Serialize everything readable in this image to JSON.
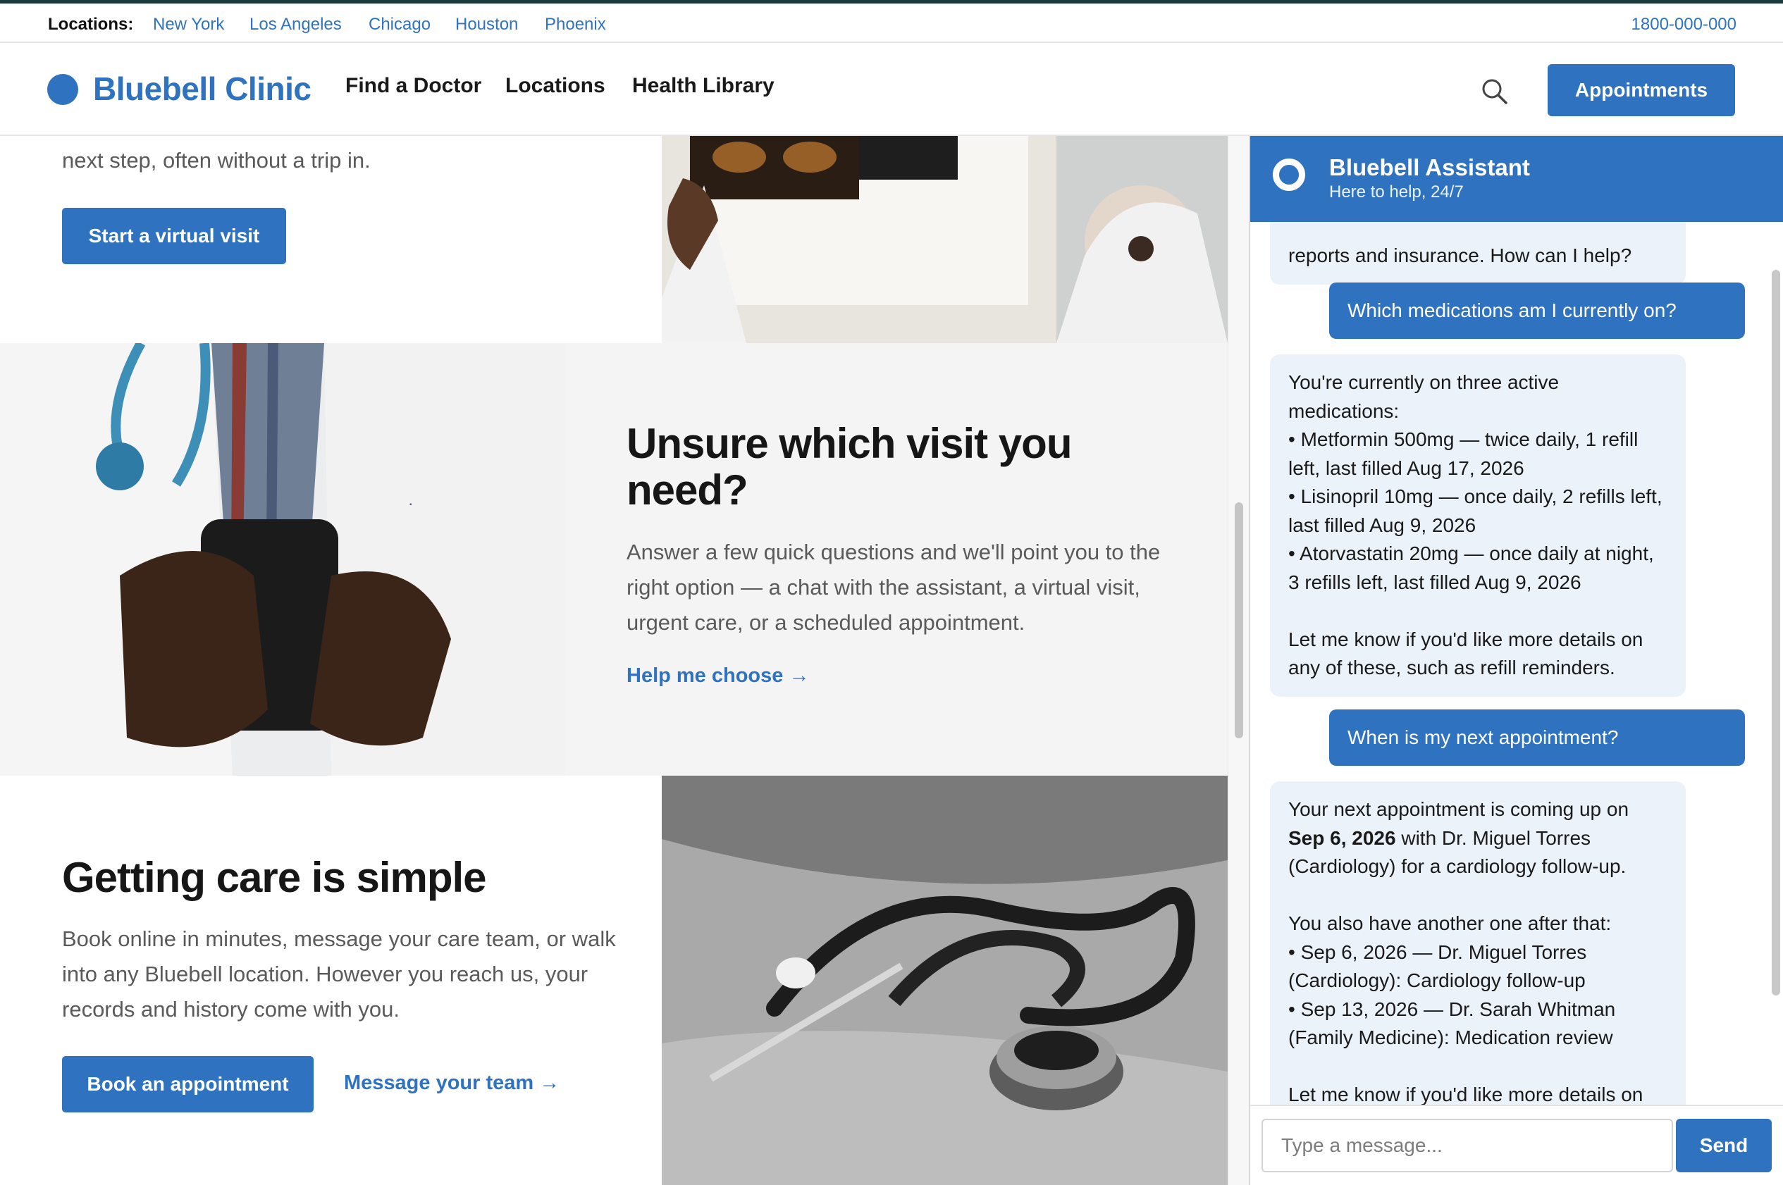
{
  "locations_bar": {
    "label": "Locations:",
    "links": [
      "New York",
      "Los Angeles",
      "Chicago",
      "Houston",
      "Phoenix"
    ],
    "phone": "1800-000-000"
  },
  "header": {
    "brand": "Bluebell Clinic",
    "nav": [
      "Find a Doctor",
      "Locations",
      "Health Library"
    ],
    "cta": "Appointments"
  },
  "sections": {
    "virtual": {
      "body": "next step, often without a trip in.",
      "button": "Start a virtual visit"
    },
    "unsure": {
      "title": "Unsure which visit you need?",
      "body": "Answer a few quick questions and we'll point you to the right option — a chat with the assistant, a virtual visit, urgent care, or a scheduled appointment.",
      "link": "Help me choose →"
    },
    "simple": {
      "title": "Getting care is simple",
      "body": "Book online in minutes, message your care team, or walk into any Bluebell location. However you reach us, your records and history come with you.",
      "button": "Book an appointment",
      "link": "Message your team →"
    }
  },
  "chat": {
    "title": "Bluebell Assistant",
    "subtitle": "Here to help, 24/7",
    "messages": [
      {
        "role": "assistant",
        "text": "reports and insurance. How can I help?"
      },
      {
        "role": "user",
        "text": "Which medications am I currently on?"
      },
      {
        "role": "assistant",
        "lines": [
          "You're currently on three active medications:",
          "• Metformin 500mg — twice daily, 1 refill left, last filled Aug 17, 2026",
          "• Lisinopril 10mg — once daily, 2 refills left, last filled Aug 9, 2026",
          "• Atorvastatin 20mg — once daily at night, 3 refills left, last filled Aug 9, 2026",
          "",
          "Let me know if you'd like more details on any of these, such as refill reminders."
        ]
      },
      {
        "role": "user",
        "text": "When is my next appointment?"
      },
      {
        "role": "assistant",
        "intro": "Your next appointment is coming up on",
        "date": "Sep 6, 2026",
        "intro_rest": "with Dr. Miguel Torres (Cardiology) for a cardiology follow-up.",
        "lines": [
          "You also have another one after that:",
          "• Sep 6, 2026 — Dr. Miguel Torres (Cardiology): Cardiology follow-up",
          "• Sep 13, 2026 — Dr. Sarah Whitman (Family Medicine): Medication review",
          "",
          "Let me know if you'd like more details on"
        ]
      }
    ],
    "input_placeholder": "Type a message...",
    "send": "Send"
  },
  "colors": {
    "accent": "#2f73c0",
    "bot_bubble": "#ebf2fa",
    "panel_gray": "#f4f4f4"
  }
}
